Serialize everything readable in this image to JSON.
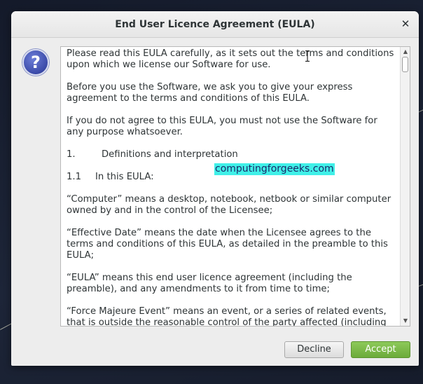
{
  "window": {
    "title": "End User Licence Agreement (EULA)",
    "close_glyph": "✕"
  },
  "icon": {
    "name": "question-icon",
    "glyph": "?"
  },
  "eula": {
    "p1": "Please read this EULA carefully, as it sets out the terms and conditions upon which we license our Software for use.",
    "p2": "Before you use the Software, we ask you to give your express agreement to the terms and conditions of this EULA.",
    "p3": "If you do not agree to this EULA, you must not use the Software for any purpose whatsoever.",
    "section_num": "1.",
    "section_title": "Definitions and interpretation",
    "subsection_num": "1.1",
    "subsection_title": "In this EULA:",
    "def_computer": "“Computer” means a desktop, notebook, netbook or similar computer owned by and in the control of the Licensee;",
    "def_effective_date": "“Effective Date” means the date when the Licensee agrees to the terms and conditions of this EULA, as detailed in the preamble to this EULA;",
    "def_eula": "“EULA” means this end user licence agreement (including the preamble), and any amendments to it from time to time;",
    "def_force_majeure": "“Force Majeure Event” means an event, or a series of related events, that is outside the reasonable control of the party affected (including"
  },
  "watermark": "computingforgeeks.com",
  "buttons": {
    "decline": "Decline",
    "accept": "Accept"
  },
  "colors": {
    "accept": "#6cab3a",
    "watermark_bg": "#40f0e8",
    "icon": "#3b4aa8"
  }
}
